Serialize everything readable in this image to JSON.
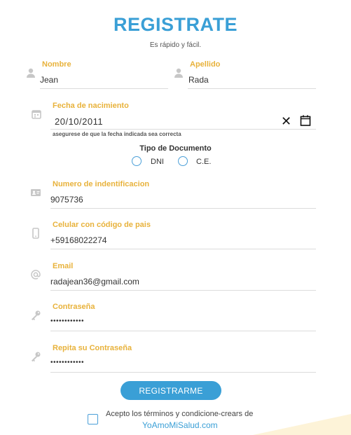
{
  "colors": {
    "accent_blue": "#3a9fd6",
    "label_orange": "#e8b23b",
    "icon_grey": "#c7c7c7",
    "button_blue": "#3a9fd6",
    "deco_yellow": "#fdf3d8"
  },
  "header": {
    "title": "REGISTRATE",
    "subtitle": "Es rápido y fácil."
  },
  "form": {
    "first_name": {
      "label": "Nombre",
      "value": "Jean",
      "icon": "person-icon"
    },
    "last_name": {
      "label": "Apellido",
      "value": "Rada",
      "icon": "person-icon"
    },
    "birth_date": {
      "label": "Fecha de nacimiento",
      "value": "20/10/2011",
      "hint": "asegurese de que la fecha indicada sea correcta",
      "clear_glyph": "✕",
      "icon": "calendar-icon"
    },
    "document_type": {
      "title": "Tipo de Documento",
      "options": [
        {
          "label": "DNI",
          "selected": false
        },
        {
          "label": "C.E.",
          "selected": false
        }
      ]
    },
    "id_number": {
      "label": "Numero de indentificacion",
      "value": "9075736",
      "icon": "id-card-icon"
    },
    "phone": {
      "label": "Celular con código de pais",
      "value": "+59168022274",
      "icon": "phone-icon"
    },
    "email": {
      "label": "Email",
      "value": "radajean36@gmail.com",
      "icon": "at-icon"
    },
    "password": {
      "label": "Contraseña",
      "value": "••••••••••••",
      "icon": "key-icon"
    },
    "password_repeat": {
      "label": "Repita su Contraseña",
      "value": "••••••••••••",
      "icon": "key-icon"
    }
  },
  "actions": {
    "submit_label": "REGISTRARME",
    "terms_text": "Acepto los términos y condicione-crears de",
    "terms_link": "YoAmoMiSalud.com",
    "terms_checked": false
  }
}
